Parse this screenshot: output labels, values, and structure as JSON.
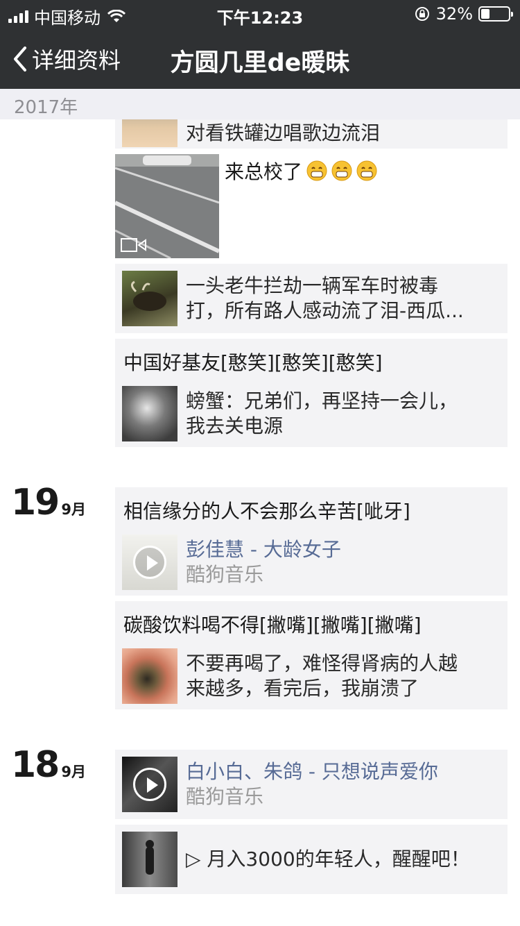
{
  "status": {
    "carrier": "中国移动",
    "time": "下午12:23",
    "battery_pct": "32%"
  },
  "nav": {
    "back_label": "详细资料",
    "title": "方圆几里de暖昧"
  },
  "year_label": "2017年",
  "posts": {
    "top_card_text": "对看铁罐边唱歌边流泪",
    "video_caption": "来总校了",
    "ox_card": {
      "line1": "一头老牛拦劫一辆军车时被毒",
      "line2": "打，所有路人感动流了泪-西瓜..."
    },
    "crab_card": {
      "caption": "中国好基友[憨笑][憨笑][憨笑]",
      "line1": "螃蟹：兄弟们，再坚持一会儿，",
      "line2": "我去关电源"
    }
  },
  "day19": {
    "day": "19",
    "month": "9月",
    "music_card": {
      "caption": "相信缘分的人不会那么辛苦[呲牙]",
      "title": "彭佳慧 - 大龄女子",
      "source": "酷狗音乐"
    },
    "soda_card": {
      "caption": "碳酸饮料喝不得[撇嘴][撇嘴][撇嘴]",
      "line1": "不要再喝了，难怪得肾病的人越",
      "line2": "来越多，看完后，我崩溃了"
    }
  },
  "day18": {
    "day": "18",
    "month": "9月",
    "music_card": {
      "title": "白小白、朱鸽 - 只想说声爱你",
      "source": "酷狗音乐"
    },
    "video_card": {
      "text": "▷ 月入3000的年轻人，醒醒吧！"
    }
  }
}
